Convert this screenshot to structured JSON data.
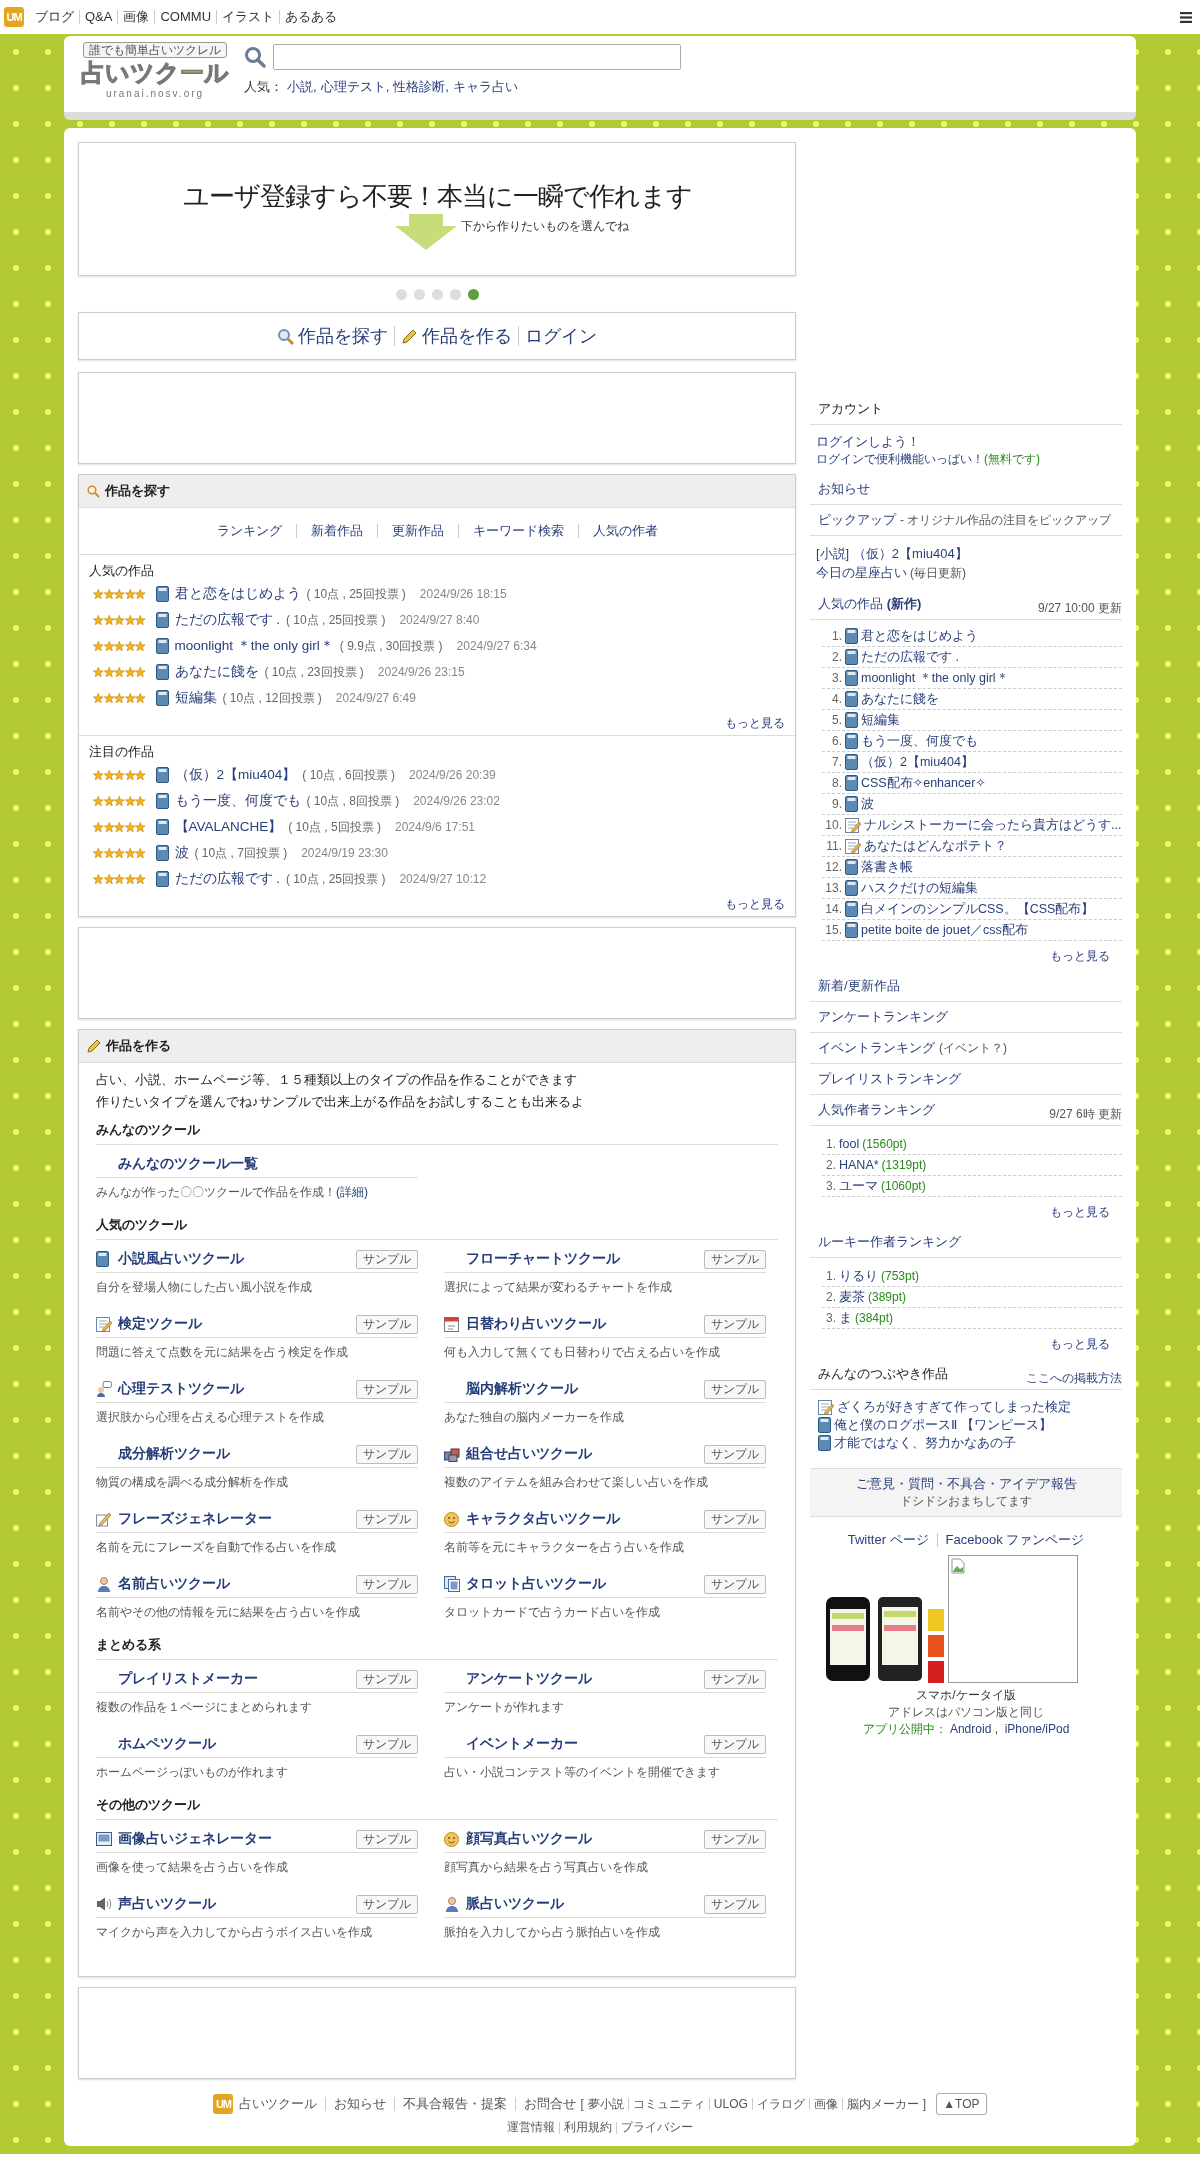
{
  "top_bar": {
    "brand_mark": "UM",
    "links": [
      "ブログ",
      "Q&A",
      "画像",
      "COMMU",
      "イラスト",
      "あるある"
    ]
  },
  "header": {
    "logo": {
      "tagline": "誰でも簡単占いツクレル",
      "name": "占いツクール",
      "url": "uranai.nosv.org"
    },
    "popular_label": "人気：",
    "popular_links": [
      "小説,",
      "心理テスト,",
      "性格診断,",
      "キャラ占い"
    ]
  },
  "banner": {
    "headline": "ユーザ登録すら不要！本当に一瞬で作れます",
    "subtext": "下から作りたいものを選んでね",
    "dots": [
      {
        "selected": false
      },
      {
        "selected": false
      },
      {
        "selected": false
      },
      {
        "selected": false
      },
      {
        "selected": true
      }
    ]
  },
  "main_nav": [
    {
      "label": "作品を探す",
      "kind": "search"
    },
    {
      "label": "作品を作る",
      "kind": "create"
    },
    {
      "label": "ログイン",
      "kind": "plain"
    }
  ],
  "find_section": {
    "title": "作品を探す",
    "tabs": [
      "ランキング",
      "新着作品",
      "更新作品",
      "キーワード検索",
      "人気の作者"
    ],
    "lists": [
      {
        "title": "人気の作品",
        "more": "もっと見る",
        "items": [
          {
            "title": "君と恋をはじめよう",
            "score": "( 10点 , 25回投票 )",
            "date": "2024/9/26 18:15",
            "stars": 5
          },
          {
            "title": "ただの広報です .",
            "score": "( 10点 , 25回投票 )",
            "date": "2024/9/27 8:40",
            "stars": 5
          },
          {
            "title": "moonlight ＊the only girl＊",
            "score": "( 9.9点 , 30回投票 )",
            "date": "2024/9/27 6:34",
            "stars": 5
          },
          {
            "title": "あなたに餞を",
            "score": "( 10点 , 23回投票 )",
            "date": "2024/9/26 23:15",
            "stars": 5
          },
          {
            "title": "短編集",
            "score": "( 10点 , 12回投票 )",
            "date": "2024/9/27 6:49",
            "stars": 5
          }
        ]
      },
      {
        "title": "注目の作品",
        "more": "もっと見る",
        "items": [
          {
            "title": "（仮）2【miu404】",
            "score": "( 10点 , 6回投票 )",
            "date": "2024/9/26 20:39",
            "stars": 5
          },
          {
            "title": "もう一度、何度でも",
            "score": "( 10点 , 8回投票 )",
            "date": "2024/9/26 23:02",
            "stars": 5
          },
          {
            "title": "【AVALANCHE】",
            "score": "( 10点 , 5回投票 )",
            "date": "2024/9/6 17:51",
            "stars": 5
          },
          {
            "title": "波",
            "score": "( 10点 , 7回投票 )",
            "date": "2024/9/19 23:30",
            "stars": 5
          },
          {
            "title": "ただの広報です .",
            "score": "( 10点 , 25回投票 )",
            "date": "2024/9/27 10:12",
            "stars": 5
          }
        ]
      }
    ]
  },
  "create_section": {
    "title": "作品を作る",
    "intro": [
      "占い、小説、ホームページ等、１５種類以上のタイプの作品を作ることができます",
      "作りたいタイプを選んでね♪サンプルで出来上がる作品をお試しすることも出来るよ"
    ],
    "groups": [
      {
        "title": "みんなのツクール",
        "tools": [
          {
            "name": "みんなのツクール一覧",
            "desc": "みんなが作った〇〇ツクールで作品を作成！",
            "desc_link": "(詳細)"
          }
        ]
      },
      {
        "title": "人気のツクール",
        "tools": [
          {
            "name": "小説風占いツクール",
            "desc": "自分を登場人物にした占い風小説を作成",
            "kind": "book",
            "sample": "サンプル"
          },
          {
            "name": "フローチャートツクール",
            "desc": "選択によって結果が変わるチャートを作成",
            "sample": "サンプル"
          },
          {
            "name": "検定ツクール",
            "desc": "問題に答えて点数を元に結果を占う検定を作成",
            "kind": "memo",
            "sample": "サンプル"
          },
          {
            "name": "日替わり占いツクール",
            "desc": "何も入力して無くても日替わりで占える占いを作成",
            "kind": "calendar",
            "sample": "サンプル"
          },
          {
            "name": "心理テストツクール",
            "desc": "選択肢から心理を占える心理テストを作成",
            "kind": "chat",
            "sample": "サンプル"
          },
          {
            "name": "脳内解析ツクール",
            "desc": "あなた独自の脳内メーカーを作成",
            "sample": "サンプル"
          },
          {
            "name": "成分解析ツクール",
            "desc": "物質の構成を調べる成分解析を作成",
            "sample": "サンプル"
          },
          {
            "name": "組合せ占いツクール",
            "desc": "複数のアイテムを組み合わせて楽しい占いを作成",
            "kind": "boxes",
            "sample": "サンプル"
          },
          {
            "name": "フレーズジェネレーター",
            "desc": "名前を元にフレーズを自動で作る占いを作成",
            "kind": "pen",
            "sample": "サンプル"
          },
          {
            "name": "キャラクタ占いツクール",
            "desc": "名前等を元にキャラクターを占う占いを作成",
            "kind": "face",
            "sample": "サンプル"
          },
          {
            "name": "名前占いツクール",
            "desc": "名前やその他の情報を元に結果を占う占いを作成",
            "kind": "person",
            "sample": "サンプル"
          },
          {
            "name": "タロット占いツクール",
            "desc": "タロットカードで占うカード占いを作成",
            "kind": "cards",
            "sample": "サンプル"
          }
        ]
      },
      {
        "title": "まとめる系",
        "tools": [
          {
            "name": "プレイリストメーカー",
            "desc": "複数の作品を１ページにまとめられます",
            "sample": "サンプル"
          },
          {
            "name": "アンケートツクール",
            "desc": "アンケートが作れます",
            "sample": "サンプル"
          },
          {
            "name": "ホムペツクール",
            "desc": "ホームページっぽいものが作れます",
            "sample": "サンプル"
          },
          {
            "name": "イベントメーカー",
            "desc": "占い・小説コンテスト等のイベントを開催できます",
            "sample": "サンプル"
          }
        ]
      },
      {
        "title": "その他のツクール",
        "tools": [
          {
            "name": "画像占いジェネレーター",
            "desc": "画像を使って結果を占う占いを作成",
            "kind": "picture",
            "sample": "サンプル"
          },
          {
            "name": "顔写真占いツクール",
            "desc": "顔写真から結果を占う写真占いを作成",
            "kind": "face",
            "sample": "サンプル"
          },
          {
            "name": "声占いツクール",
            "desc": "マイクから声を入力してから占うボイス占いを作成",
            "kind": "speaker",
            "sample": "サンプル"
          },
          {
            "name": "脈占いツクール",
            "desc": "脈拍を入力してから占う脈拍占いを作成",
            "kind": "person",
            "sample": "サンプル"
          }
        ]
      }
    ]
  },
  "sidebar": {
    "account": {
      "title": "アカウント",
      "login": "ログインしよう！",
      "login_sub": "ログインで便利機能いっぱい！",
      "free": "(無料です)"
    },
    "news": "お知らせ",
    "pickup": {
      "title": "ピックアップ",
      "subtitle": "- オリジナル作品の注目をピックアップ",
      "items": [
        {
          "text": "[小説] （仮）2【miu404】"
        },
        {
          "text": "今日の星座占い",
          "note": "(毎日更新)"
        }
      ]
    },
    "popular_new": {
      "title": "人気の作品 **(新作)**",
      "updated": "9/27 10:00 更新",
      "more": "もっと見る",
      "items": [
        {
          "rank": "1.",
          "title": "君と恋をはじめよう",
          "kind": "book"
        },
        {
          "rank": "2.",
          "title": "ただの広報です .",
          "kind": "book"
        },
        {
          "rank": "3.",
          "title": "moonlight ＊the only girl＊",
          "kind": "book"
        },
        {
          "rank": "4.",
          "title": "あなたに餞を",
          "kind": "book"
        },
        {
          "rank": "5.",
          "title": "短編集",
          "kind": "book"
        },
        {
          "rank": "6.",
          "title": "もう一度、何度でも",
          "kind": "book"
        },
        {
          "rank": "7.",
          "title": "（仮）2【miu404】",
          "kind": "book"
        },
        {
          "rank": "8.",
          "title": "CSS配布✧enhancer✧",
          "kind": "book"
        },
        {
          "rank": "9.",
          "title": "波",
          "kind": "book"
        },
        {
          "rank": "10.",
          "title": "ナルシストーカーに会ったら貴方はどうす...",
          "kind": "memo"
        },
        {
          "rank": "11.",
          "title": "あなたはどんなポテト？",
          "kind": "memo"
        },
        {
          "rank": "12.",
          "title": "落書き帳",
          "kind": "book"
        },
        {
          "rank": "13.",
          "title": "ハスクだけの短編集",
          "kind": "book"
        },
        {
          "rank": "14.",
          "title": "白メインのシンプルCSS。【CSS配布】",
          "kind": "book"
        },
        {
          "rank": "15.",
          "title": "petite boite de jouet／css配布",
          "kind": "book"
        }
      ]
    },
    "links": [
      {
        "label": "新着/更新作品"
      },
      {
        "label": "アンケートランキング"
      },
      {
        "label": "イベントランキング",
        "note": "(イベント？)"
      },
      {
        "label": "プレイリストランキング"
      }
    ],
    "author_ranking": {
      "title": "人気作者ランキング",
      "updated": "9/27 6時 更新",
      "more": "もっと見る",
      "items": [
        {
          "rank": "1.",
          "name": "fool",
          "points": "(1560pt)"
        },
        {
          "rank": "2.",
          "name": "HANA*",
          "points": "(1319pt)"
        },
        {
          "rank": "3.",
          "name": "ユーマ",
          "points": "(1060pt)"
        }
      ]
    },
    "rookie_ranking": {
      "title": "ルーキー作者ランキング",
      "more": "もっと見る",
      "items": [
        {
          "rank": "1.",
          "name": "りるり",
          "points": "(753pt)"
        },
        {
          "rank": "2.",
          "name": "麦茶",
          "points": "(389pt)"
        },
        {
          "rank": "3.",
          "name": "ま",
          "points": "(384pt)"
        }
      ]
    },
    "tweets": {
      "title": "みんなのつぶやき作品",
      "howto": "ここへの掲載方法",
      "items": [
        {
          "title": "ざくろが好きすぎて作ってしまった検定",
          "kind": "memo"
        },
        {
          "title": "俺と僕のログポースⅡ 【ワンピース】",
          "kind": "book"
        },
        {
          "title": "才能ではなく、努力かなあの子",
          "kind": "book"
        }
      ]
    },
    "feedback": {
      "title": "ご意見・質問・不具合・アイデア報告",
      "subtitle": "ドシドシおまちしてます"
    },
    "social": [
      "Twitter ページ",
      "Facebook ファンページ"
    ],
    "mobile": {
      "title": "スマホ/ケータイ版",
      "note": "アドレスはパソコン版と同じ",
      "app_label": "アプリ公開中：",
      "app_links": [
        "Android",
        "iPhone/iPod"
      ],
      "app_sep": " , "
    }
  },
  "footer": {
    "brand_mark": "UM",
    "links": [
      "占いツクール",
      "お知らせ",
      "不具合報告・提案",
      "お問合せ"
    ],
    "bracket_open": "[",
    "sub_links": [
      "夢小説",
      "コミュニティ",
      "ULOG",
      "イラログ",
      "画像",
      "脳内メーカー"
    ],
    "bracket_close": "]",
    "top_button": "▲TOP",
    "bottom_links": [
      "運営情報",
      "利用規約",
      "プライバシー"
    ]
  }
}
